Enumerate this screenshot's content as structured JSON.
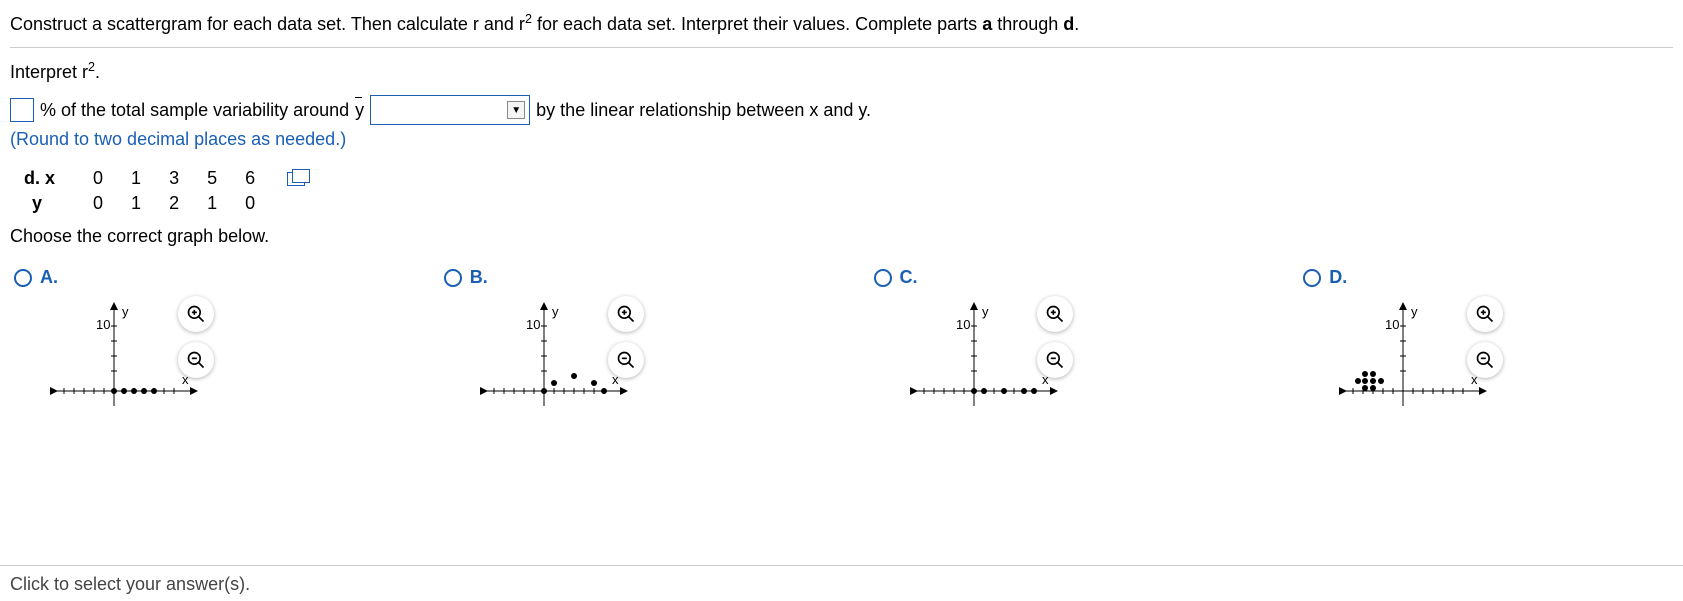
{
  "intro": {
    "text_a": "Construct a scattergram for each data set. Then calculate r and r",
    "sup1": "2",
    "text_b": " for each data set. Interpret their values. Complete parts ",
    "bold_a": "a",
    "text_c": " through ",
    "bold_d": "d",
    "text_d": "."
  },
  "interpret": {
    "label_a": "Interpret r",
    "sup": "2",
    "label_b": "."
  },
  "fill": {
    "text1": "% of the total sample variability around ",
    "ybar": "y",
    "text2": " by the linear relationship between x and y.",
    "round": "(Round to two decimal places as needed.)"
  },
  "table": {
    "part_label": "d.",
    "row_x_label": "x",
    "row_y_label": "y",
    "x": [
      "0",
      "1",
      "3",
      "5",
      "6"
    ],
    "y": [
      "0",
      "1",
      "2",
      "1",
      "0"
    ]
  },
  "choose": "Choose the correct graph below.",
  "options": {
    "A": "A.",
    "B": "B.",
    "C": "C.",
    "D": "D.",
    "ylabel": "y",
    "xlabel": "x",
    "ytick": "10"
  },
  "footer": "Click to select your answer(s).",
  "chart_data": [
    {
      "type": "scatter",
      "option": "A",
      "xlim": [
        -8,
        8
      ],
      "ylim": [
        -2,
        10
      ],
      "points": [
        [
          0,
          0
        ],
        [
          1,
          0
        ],
        [
          2,
          0
        ],
        [
          3,
          0
        ],
        [
          4,
          0
        ]
      ],
      "xlabel": "x",
      "ylabel": "y"
    },
    {
      "type": "scatter",
      "option": "B",
      "xlim": [
        -8,
        8
      ],
      "ylim": [
        -2,
        10
      ],
      "points": [
        [
          0,
          0
        ],
        [
          1,
          1
        ],
        [
          3,
          2
        ],
        [
          5,
          1
        ],
        [
          6,
          0
        ]
      ],
      "xlabel": "x",
      "ylabel": "y"
    },
    {
      "type": "scatter",
      "option": "C",
      "xlim": [
        -8,
        8
      ],
      "ylim": [
        -2,
        10
      ],
      "points": [
        [
          0,
          0
        ],
        [
          1,
          0
        ],
        [
          3,
          0
        ],
        [
          5,
          0
        ],
        [
          6,
          0
        ]
      ],
      "xlabel": "x",
      "ylabel": "y"
    },
    {
      "type": "scatter",
      "option": "D",
      "xlim": [
        -8,
        8
      ],
      "ylim": [
        -2,
        10
      ],
      "points": [
        [
          -5,
          1
        ],
        [
          -4,
          0
        ],
        [
          -4,
          1
        ],
        [
          -4,
          2
        ],
        [
          -3,
          0
        ],
        [
          -3,
          1
        ],
        [
          -3,
          2
        ],
        [
          -2,
          1
        ]
      ],
      "xlabel": "x",
      "ylabel": "y"
    }
  ]
}
